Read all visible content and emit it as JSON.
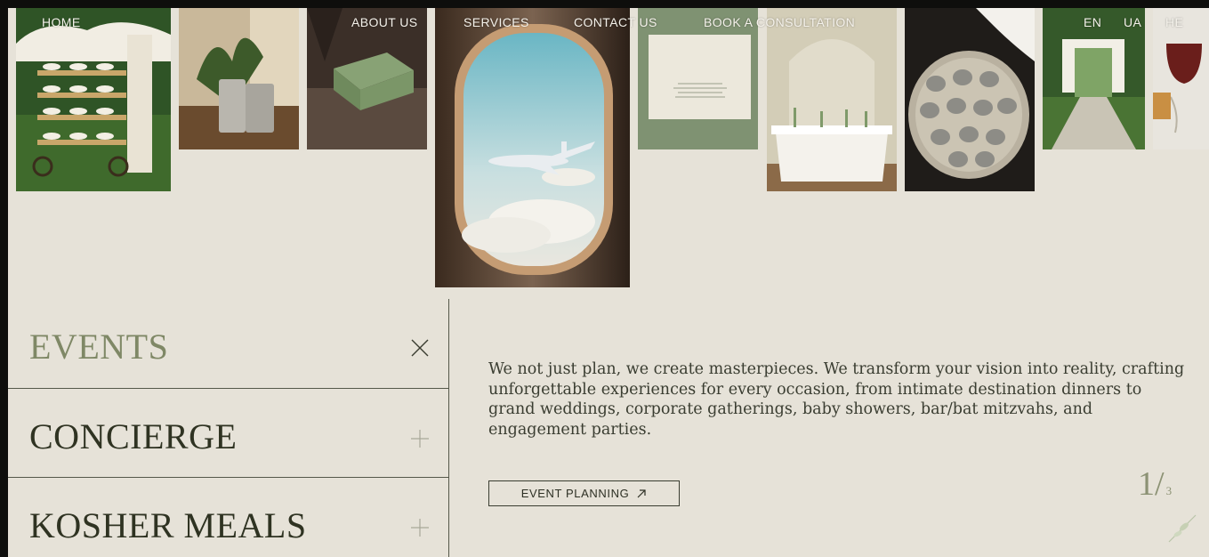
{
  "nav": {
    "left": [
      "HOME",
      "ABOUT US",
      "SERVICES",
      "CONTACT US",
      "BOOK A CONSULTATION"
    ],
    "languages": [
      "EN",
      "UA",
      "HE"
    ]
  },
  "gallery": {
    "tiles": [
      {
        "name": "dessert-cart-photo"
      },
      {
        "name": "luggage-photo"
      },
      {
        "name": "gift-box-photo"
      },
      {
        "name": "airplane-window-photo"
      },
      {
        "name": "invitation-card-photo"
      },
      {
        "name": "dining-table-photo"
      },
      {
        "name": "cloche-tray-photo"
      },
      {
        "name": "wedding-aisle-photo"
      },
      {
        "name": "wine-glass-photo"
      }
    ]
  },
  "services": {
    "items": [
      {
        "label": "EVENTS",
        "icon": "close-icon",
        "active": true
      },
      {
        "label": "CONCIERGE",
        "icon": "plus-icon",
        "active": false
      },
      {
        "label": "KOSHER MEALS",
        "icon": "plus-icon",
        "active": false
      }
    ]
  },
  "detail": {
    "description": "We not just plan, we create masterpieces. We transform your vision into reality, crafting unforgettable experiences for every occasion, from intimate destination dinners to grand weddings, corporate gatherings, baby showers, bar/bat mitzvahs, and engagement parties.",
    "cta_label": "EVENT PLANNING",
    "cta_icon": "arrow-up-right-icon",
    "pager_current": "1/",
    "pager_total": "3"
  },
  "colors": {
    "background": "#e6e2d8",
    "active_title": "#7f8866",
    "inactive_title": "#2f3322",
    "divider": "#55584a"
  }
}
